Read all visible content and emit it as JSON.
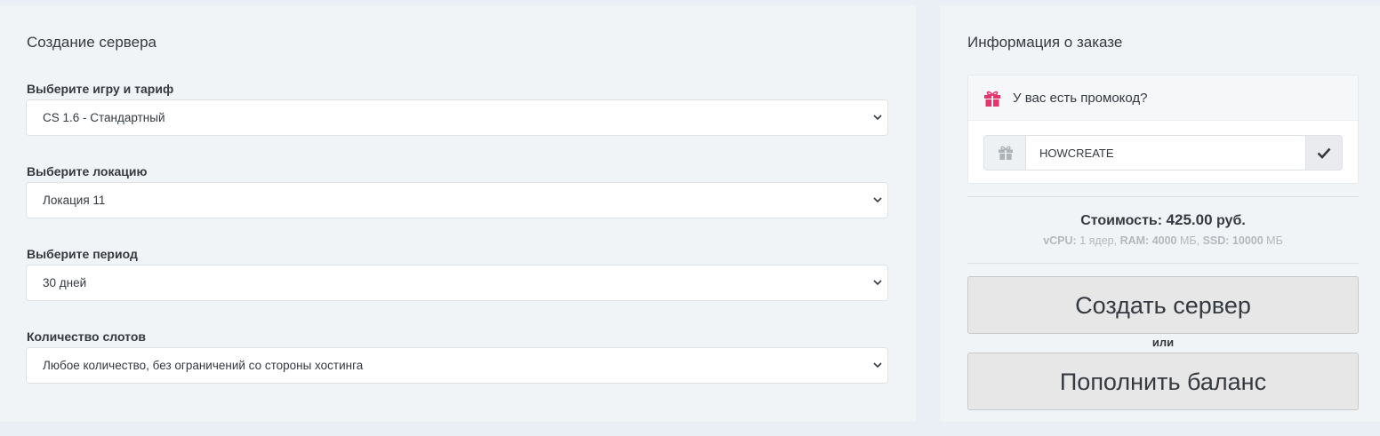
{
  "create": {
    "title": "Создание сервера",
    "fields": [
      {
        "label": "Выберите игру и тариф",
        "value": "CS 1.6 - Стандартный"
      },
      {
        "label": "Выберите локацию",
        "value": "Локация 11"
      },
      {
        "label": "Выберите период",
        "value": "30 дней"
      },
      {
        "label": "Количество слотов",
        "value": "Любое количество, без ограничений со стороны хостинга"
      }
    ]
  },
  "order": {
    "title": "Информация о заказе",
    "promo_question": "У вас есть промокод?",
    "promo_code": "HOWCREATE",
    "cost_label": "Стоимость:",
    "cost_value": "425.00",
    "cost_currency": "руб.",
    "specs": {
      "vcpu_label": "vCPU:",
      "vcpu_value": "1 ядер,",
      "ram_label": "RAM:",
      "ram_value": "4000",
      "mb1": "МБ,",
      "ssd_label": "SSD:",
      "ssd_value": "10000",
      "mb2": "МБ"
    },
    "create_button": "Создать сервер",
    "or_text": "или",
    "topup_button": "Пополнить баланс"
  },
  "colors": {
    "page_bg": "#e9eff5",
    "card_bg": "#f1f4f7",
    "gift_accent": "#e8336c",
    "button_bg": "#e7e7e7"
  },
  "icons": {
    "select_chevron": "chevron-down-icon",
    "promo_header": "gift-icon",
    "promo_prefix": "gift-icon",
    "promo_submit": "check-icon"
  }
}
